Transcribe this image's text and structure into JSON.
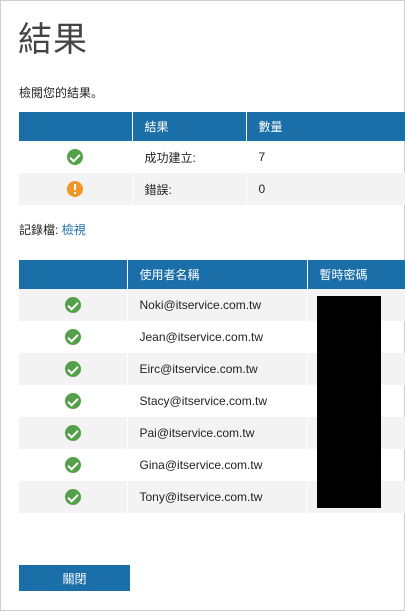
{
  "title": "結果",
  "intro": "檢閱您的結果。",
  "summary": {
    "headers": [
      "",
      "結果",
      "數量"
    ],
    "rows": [
      {
        "icon": "success-check-icon",
        "label": "成功建立:",
        "count": "7"
      },
      {
        "icon": "warning-exclamation-icon",
        "label": "錯誤:",
        "count": "0"
      }
    ]
  },
  "log": {
    "label": "記錄檔:",
    "link": "檢視"
  },
  "users": {
    "headers": [
      "",
      "使用者名稱",
      "暫時密碼"
    ],
    "rows": [
      {
        "icon": "success-check-icon",
        "username": "Noki@itservice.com.tw"
      },
      {
        "icon": "success-check-icon",
        "username": "Jean@itservice.com.tw"
      },
      {
        "icon": "success-check-icon",
        "username": "Eirc@itservice.com.tw"
      },
      {
        "icon": "success-check-icon",
        "username": "Stacy@itservice.com.tw"
      },
      {
        "icon": "success-check-icon",
        "username": "Pai@itservice.com.tw"
      },
      {
        "icon": "success-check-icon",
        "username": "Gina@itservice.com.tw"
      },
      {
        "icon": "success-check-icon",
        "username": "Tony@itservice.com.tw"
      }
    ]
  },
  "close_label": "關閉",
  "colors": {
    "accent": "#1b6fa8",
    "success": "#55a04a",
    "warning": "#f0962a",
    "row_alt": "#f3f3f3"
  }
}
